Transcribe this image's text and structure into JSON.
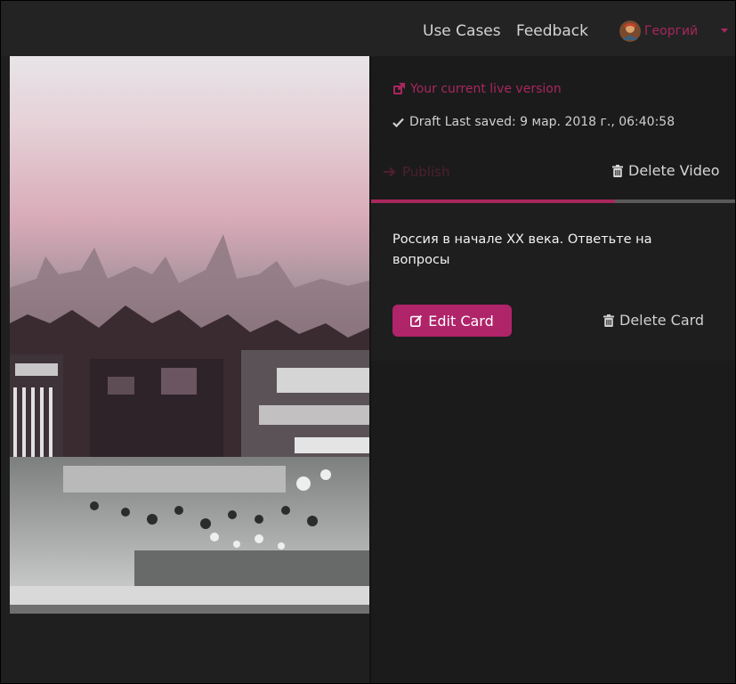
{
  "nav": {
    "use_cases": "Use Cases",
    "feedback": "Feedback",
    "user_name": "Георгий",
    "user_menu_icon": "chevron-down-icon"
  },
  "version": {
    "live_label": "Your current live version",
    "live_icon": "external-link-icon",
    "draft_label": "Draft Last saved: 9 мар. 2018 г., 06:40:58",
    "draft_icon": "check-icon"
  },
  "actions": {
    "publish_label": "Publish",
    "publish_icon": "arrow-right-icon",
    "delete_video_label": "Delete Video",
    "delete_video_icon": "trash-icon"
  },
  "progress": {
    "value_fraction": 0.67
  },
  "card": {
    "text": "Россия в начале XX века. Ответьте на вопросы",
    "edit_label": "Edit Card",
    "edit_icon": "edit-icon",
    "delete_label": "Delete Card",
    "delete_icon": "trash-icon"
  },
  "colors": {
    "accent": "#a8275c",
    "button": "#b0246a",
    "background": "#1b1b1b",
    "topbar": "#232323"
  }
}
